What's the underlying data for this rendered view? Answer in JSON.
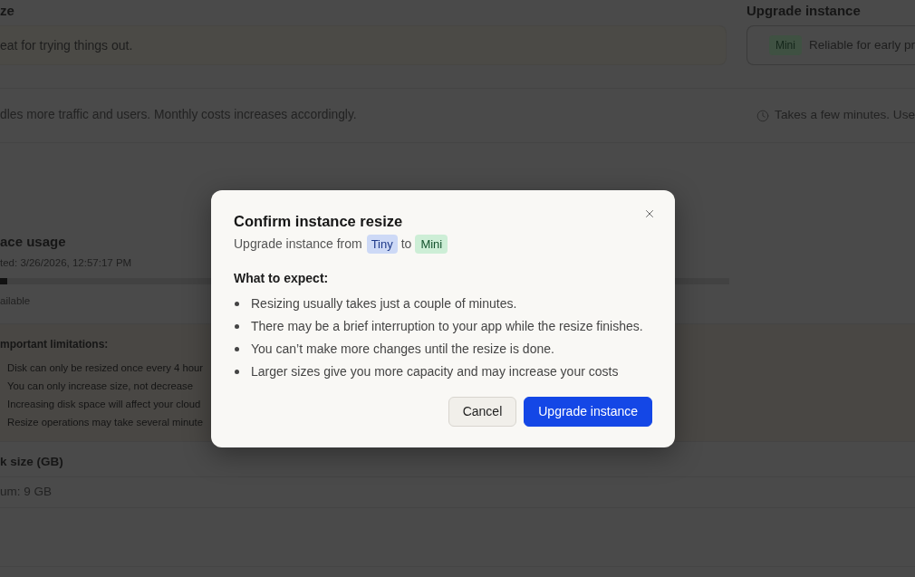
{
  "plan": {
    "current": {
      "heading": "ze",
      "description": "eat for trying things out.",
      "note": "dles more traffic and users. Monthly costs increases accordingly."
    },
    "upgrade": {
      "heading": "Upgrade instance",
      "badge": "Mini",
      "description": "Reliable for early pr",
      "note": "Takes a few minutes. Use"
    }
  },
  "disk": {
    "usage": {
      "heading": "ace usage",
      "updated": "ted: 3/26/2026, 12:57:17 PM",
      "level": 0.01,
      "available": "ailable"
    },
    "limitations": {
      "heading": "mportant limitations:",
      "items": [
        "Disk can only be resized once every 4 hour",
        "You can only increase size, not decrease",
        "Increasing disk space will affect your cloud",
        "Resize operations may take several minute"
      ]
    },
    "size": {
      "label": "k size (GB)",
      "hint": "um: 9 GB"
    }
  },
  "dialog": {
    "title": "Confirm instance resize",
    "subtitle": {
      "text": "Upgrade instance from",
      "from": "Tiny",
      "joiner": "to",
      "to": "Mini"
    },
    "expect_heading": "What to expect:",
    "expectations": [
      "Resizing usually takes just a couple of minutes.",
      "There may be a brief interruption to your app while the resize finishes.",
      "You can’t make more changes until the resize is done.",
      "Larger sizes give you more capacity and may increase your costs"
    ],
    "buttons": [
      {
        "label": "Cancel",
        "kind": "secondary"
      },
      {
        "label": "Upgrade instance",
        "kind": "primary"
      }
    ]
  }
}
